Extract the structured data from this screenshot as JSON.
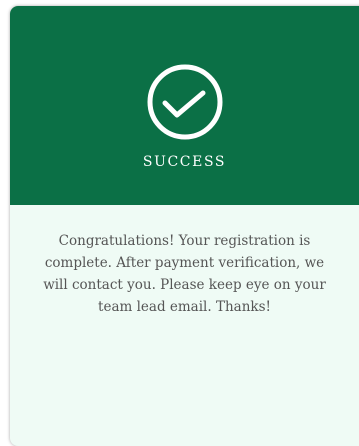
{
  "dialog": {
    "title": "SUCCESS",
    "message": "Congratulations! Your registration is complete. After payment verification, we will contact you. Please keep eye on your team lead email. Thanks!",
    "icon": "check-circle-icon",
    "colors": {
      "header": "#0b7046",
      "body": "#effbf5",
      "text": "#555555"
    }
  }
}
